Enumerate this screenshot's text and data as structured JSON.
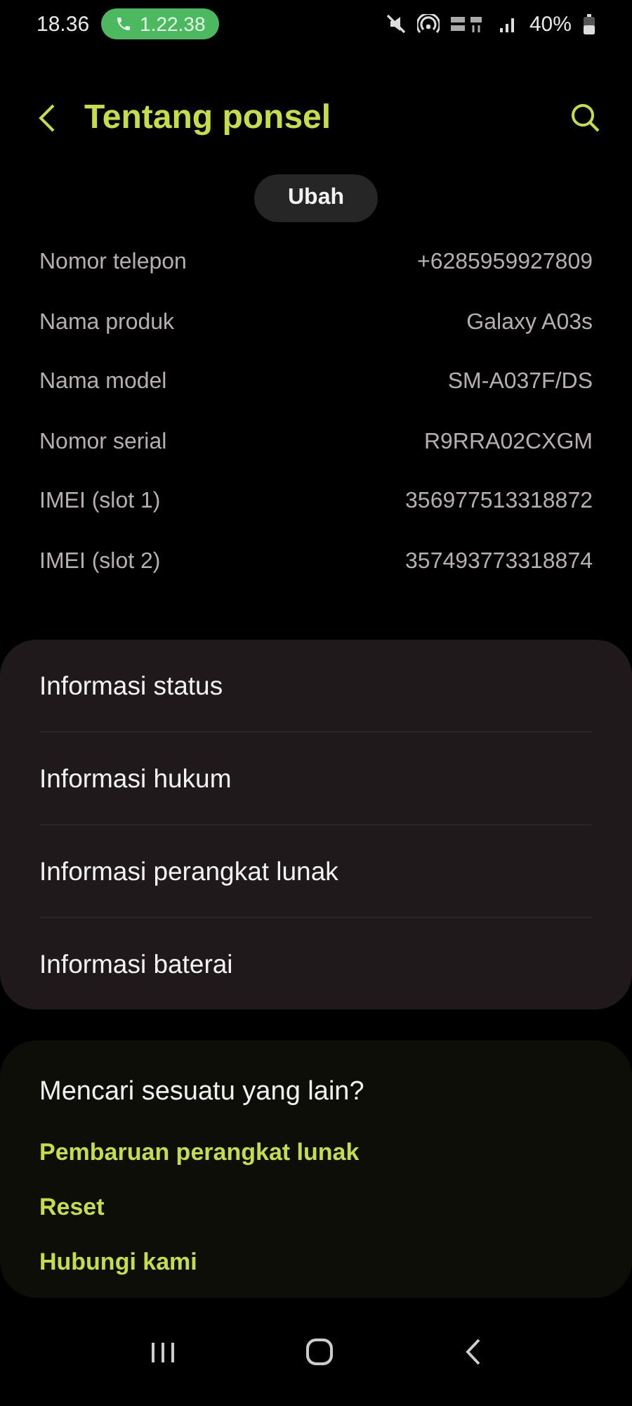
{
  "status_bar": {
    "time": "18.36",
    "call_duration": "1.22.38",
    "battery": "40%"
  },
  "header": {
    "title": "Tentang ponsel"
  },
  "edit_button": "Ubah",
  "info_rows": [
    {
      "label": "Nomor telepon",
      "value": "+6285959927809"
    },
    {
      "label": "Nama produk",
      "value": "Galaxy A03s"
    },
    {
      "label": "Nama model",
      "value": "SM-A037F/DS"
    },
    {
      "label": "Nomor serial",
      "value": "R9RRA02CXGM"
    },
    {
      "label": "IMEI (slot 1)",
      "value": "356977513318872"
    },
    {
      "label": "IMEI (slot 2)",
      "value": "357493773318874"
    }
  ],
  "menu_items": [
    "Informasi status",
    "Informasi hukum",
    "Informasi perangkat lunak",
    "Informasi baterai"
  ],
  "suggestions": {
    "title": "Mencari sesuatu yang lain?",
    "links": [
      "Pembaruan perangkat lunak",
      "Reset",
      "Hubungi kami"
    ]
  }
}
